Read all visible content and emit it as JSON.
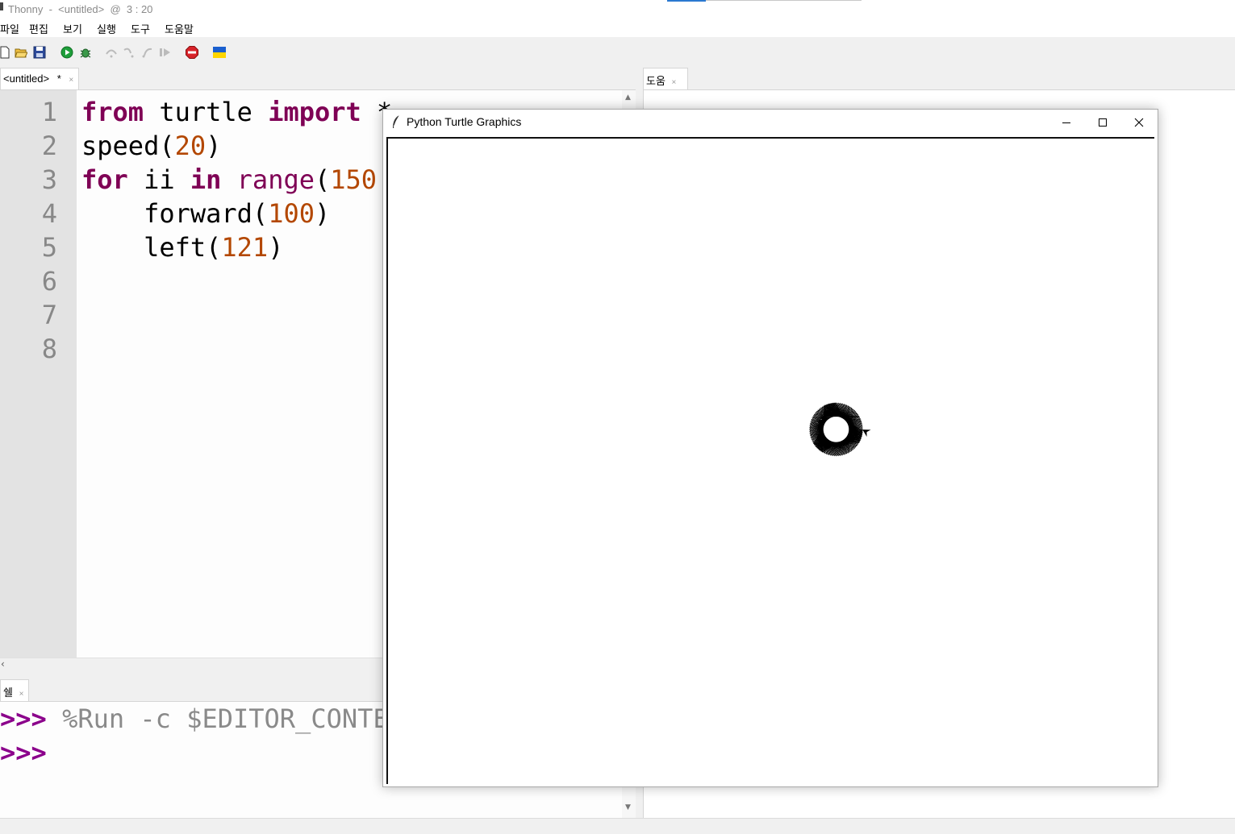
{
  "window": {
    "title": "Thonny  -  <untitled>  @  3 : 20"
  },
  "menu": {
    "items": [
      "파일",
      "편집",
      "보기",
      "실행",
      "도구",
      "도움말"
    ]
  },
  "toolbar": {
    "icons": [
      "new-file-icon",
      "open-folder-icon",
      "save-icon",
      "run-icon",
      "debug-icon",
      "step-over-icon",
      "step-into-icon",
      "step-out-icon",
      "resume-icon",
      "stop-icon",
      "ukraine-flag-icon"
    ]
  },
  "editor": {
    "tab_label": "<untitled>",
    "tab_modified": "*",
    "tab_close": "×",
    "line_numbers": [
      "1",
      "2",
      "3",
      "4",
      "5",
      "6",
      "7",
      "8"
    ],
    "code": {
      "l1_from": "from",
      "l1_mod": " turtle ",
      "l1_import": "import",
      "l1_star": " *",
      "l2_fn": "speed(",
      "l2_num": "20",
      "l2_end": ")",
      "l3_for": "for",
      "l3_var": " ii ",
      "l3_in": "in",
      "l3_space": " ",
      "l3_range": "range",
      "l3_paren": "(",
      "l3_num": "150",
      "l4_fn": "    forward(",
      "l4_num": "100",
      "l4_end": ")",
      "l5_fn": "    left(",
      "l5_num": "121",
      "l5_end": ")"
    }
  },
  "shell": {
    "tab_label": "쉘",
    "tab_close": "×",
    "prompt": ">>>",
    "command": " %Run -c $EDITOR_CONTENT"
  },
  "help": {
    "tab_label": "도움",
    "tab_close": "×"
  },
  "turtle_window": {
    "title": "Python Turtle Graphics",
    "pattern": {
      "iterations": 150,
      "step": 100,
      "turn_deg": 121
    }
  },
  "colors": {
    "keyword": "#7f0055",
    "number": "#b34700",
    "prompt": "#8b008b"
  }
}
